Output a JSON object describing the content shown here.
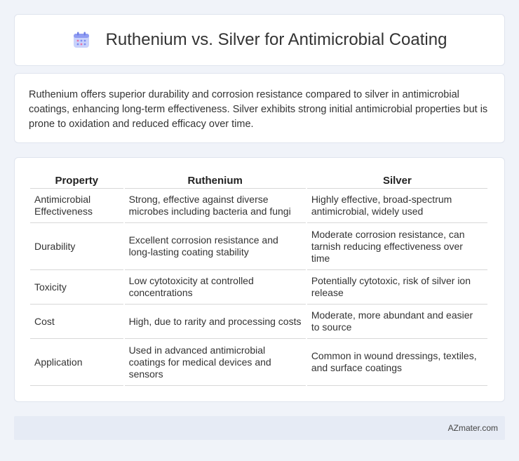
{
  "header": {
    "icon": "calendar-icon",
    "title": "Ruthenium vs. Silver for Antimicrobial Coating"
  },
  "intro": {
    "text": "Ruthenium offers superior durability and corrosion resistance compared to silver in antimicrobial coatings, enhancing long-term effectiveness. Silver exhibits strong initial antimicrobial properties but is prone to oxidation and reduced efficacy over time."
  },
  "table": {
    "headers": [
      "Property",
      "Ruthenium",
      "Silver"
    ],
    "rows": [
      [
        "Antimicrobial Effectiveness",
        "Strong, effective against diverse microbes including bacteria and fungi",
        "Highly effective, broad-spectrum antimicrobial, widely used"
      ],
      [
        "Durability",
        "Excellent corrosion resistance and long-lasting coating stability",
        "Moderate corrosion resistance, can tarnish reducing effectiveness over time"
      ],
      [
        "Toxicity",
        "Low cytotoxicity at controlled concentrations",
        "Potentially cytotoxic, risk of silver ion release"
      ],
      [
        "Cost",
        "High, due to rarity and processing costs",
        "Moderate, more abundant and easier to source"
      ],
      [
        "Application",
        "Used in advanced antimicrobial coatings for medical devices and sensors",
        "Common in wound dressings, textiles, and surface coatings"
      ]
    ]
  },
  "footer": {
    "brand": "AZmater.com"
  },
  "colors": {
    "background": "#f0f3f9",
    "card": "#ffffff",
    "footer": "#e6ebf5",
    "icon_accent": "#7b8cf0"
  }
}
